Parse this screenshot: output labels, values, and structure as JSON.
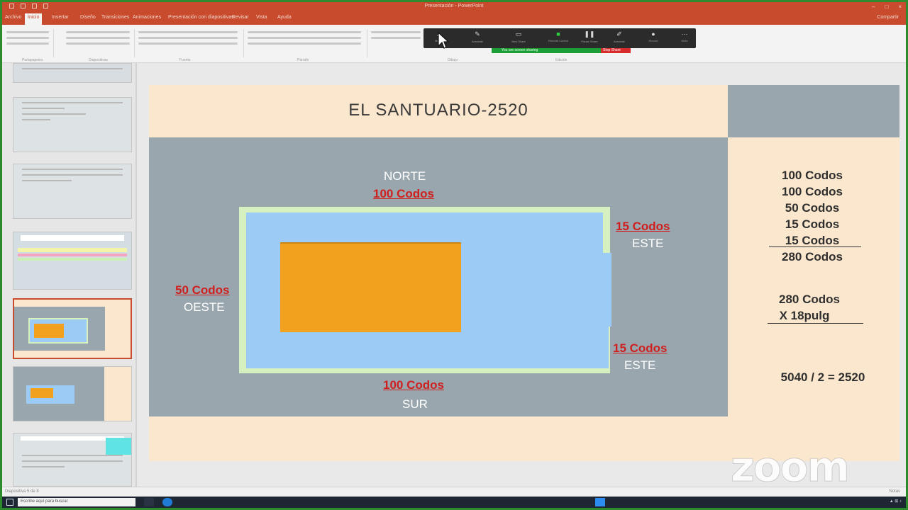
{
  "window": {
    "title": "Presentación - PowerPoint",
    "share_label": "Compartir"
  },
  "ribbon_tabs": [
    "Archivo",
    "Inicio",
    "Insertar",
    "Diseño",
    "Transiciones",
    "Animaciones",
    "Presentación con diapositivas",
    "Revisar",
    "Vista",
    "Ayuda"
  ],
  "ribbon_groups": [
    "Portapapeles",
    "Diapositivas",
    "Fuente",
    "Párrafo",
    "Dibujo",
    "Edición"
  ],
  "zoom_toolbar": {
    "buttons": [
      {
        "icon": "pointer-icon",
        "label": "Mouse"
      },
      {
        "icon": "annotate-icon",
        "label": "Annotate"
      },
      {
        "icon": "new-share-icon",
        "label": "New Share"
      },
      {
        "icon": "remote-control-icon",
        "label": "Remote Control"
      },
      {
        "icon": "pause-share-icon",
        "label": "Pause Share"
      },
      {
        "icon": "annotate-pen-icon",
        "label": "Annotate"
      },
      {
        "icon": "record-icon",
        "label": "Record"
      },
      {
        "icon": "more-icon",
        "label": "More"
      }
    ],
    "status_text": "You are screen sharing",
    "stop_label": "Stop Share",
    "status_color": "#1d9e36",
    "stop_color": "#d92b2b"
  },
  "slide": {
    "title": "EL SANTUARIO-2520",
    "labels": {
      "norte": "NORTE",
      "norte_measure": "100 Codos",
      "oeste": "OESTE",
      "oeste_measure": "50 Codos",
      "este_top_measure": "15 Codos",
      "este_top": "ESTE",
      "este_bottom_measure": "15 Codos",
      "este_bottom": "ESTE",
      "sur_measure": "100 Codos",
      "sur": "SUR"
    },
    "sum_lines": [
      "100 Codos",
      "100 Codos",
      "50 Codos",
      "15 Codos",
      "15 Codos"
    ],
    "sum_total": "280 Codos",
    "mult_lines": [
      "280 Codos",
      "X 18pulg"
    ],
    "result": "5040 / 2 = 2520",
    "colors": {
      "background": "#fbe7cd",
      "gray": "#9aa6ad",
      "court_border": "#d6f0bf",
      "court": "#9cccf5",
      "sanctuary": "#f2a11f",
      "red_text": "#cf1f1f"
    }
  },
  "watermark": "zoom",
  "statusbar": {
    "left": "Diapositiva 5 de 8",
    "right": "Notas"
  },
  "taskbar": {
    "search_placeholder": "Escribe aquí para buscar"
  }
}
